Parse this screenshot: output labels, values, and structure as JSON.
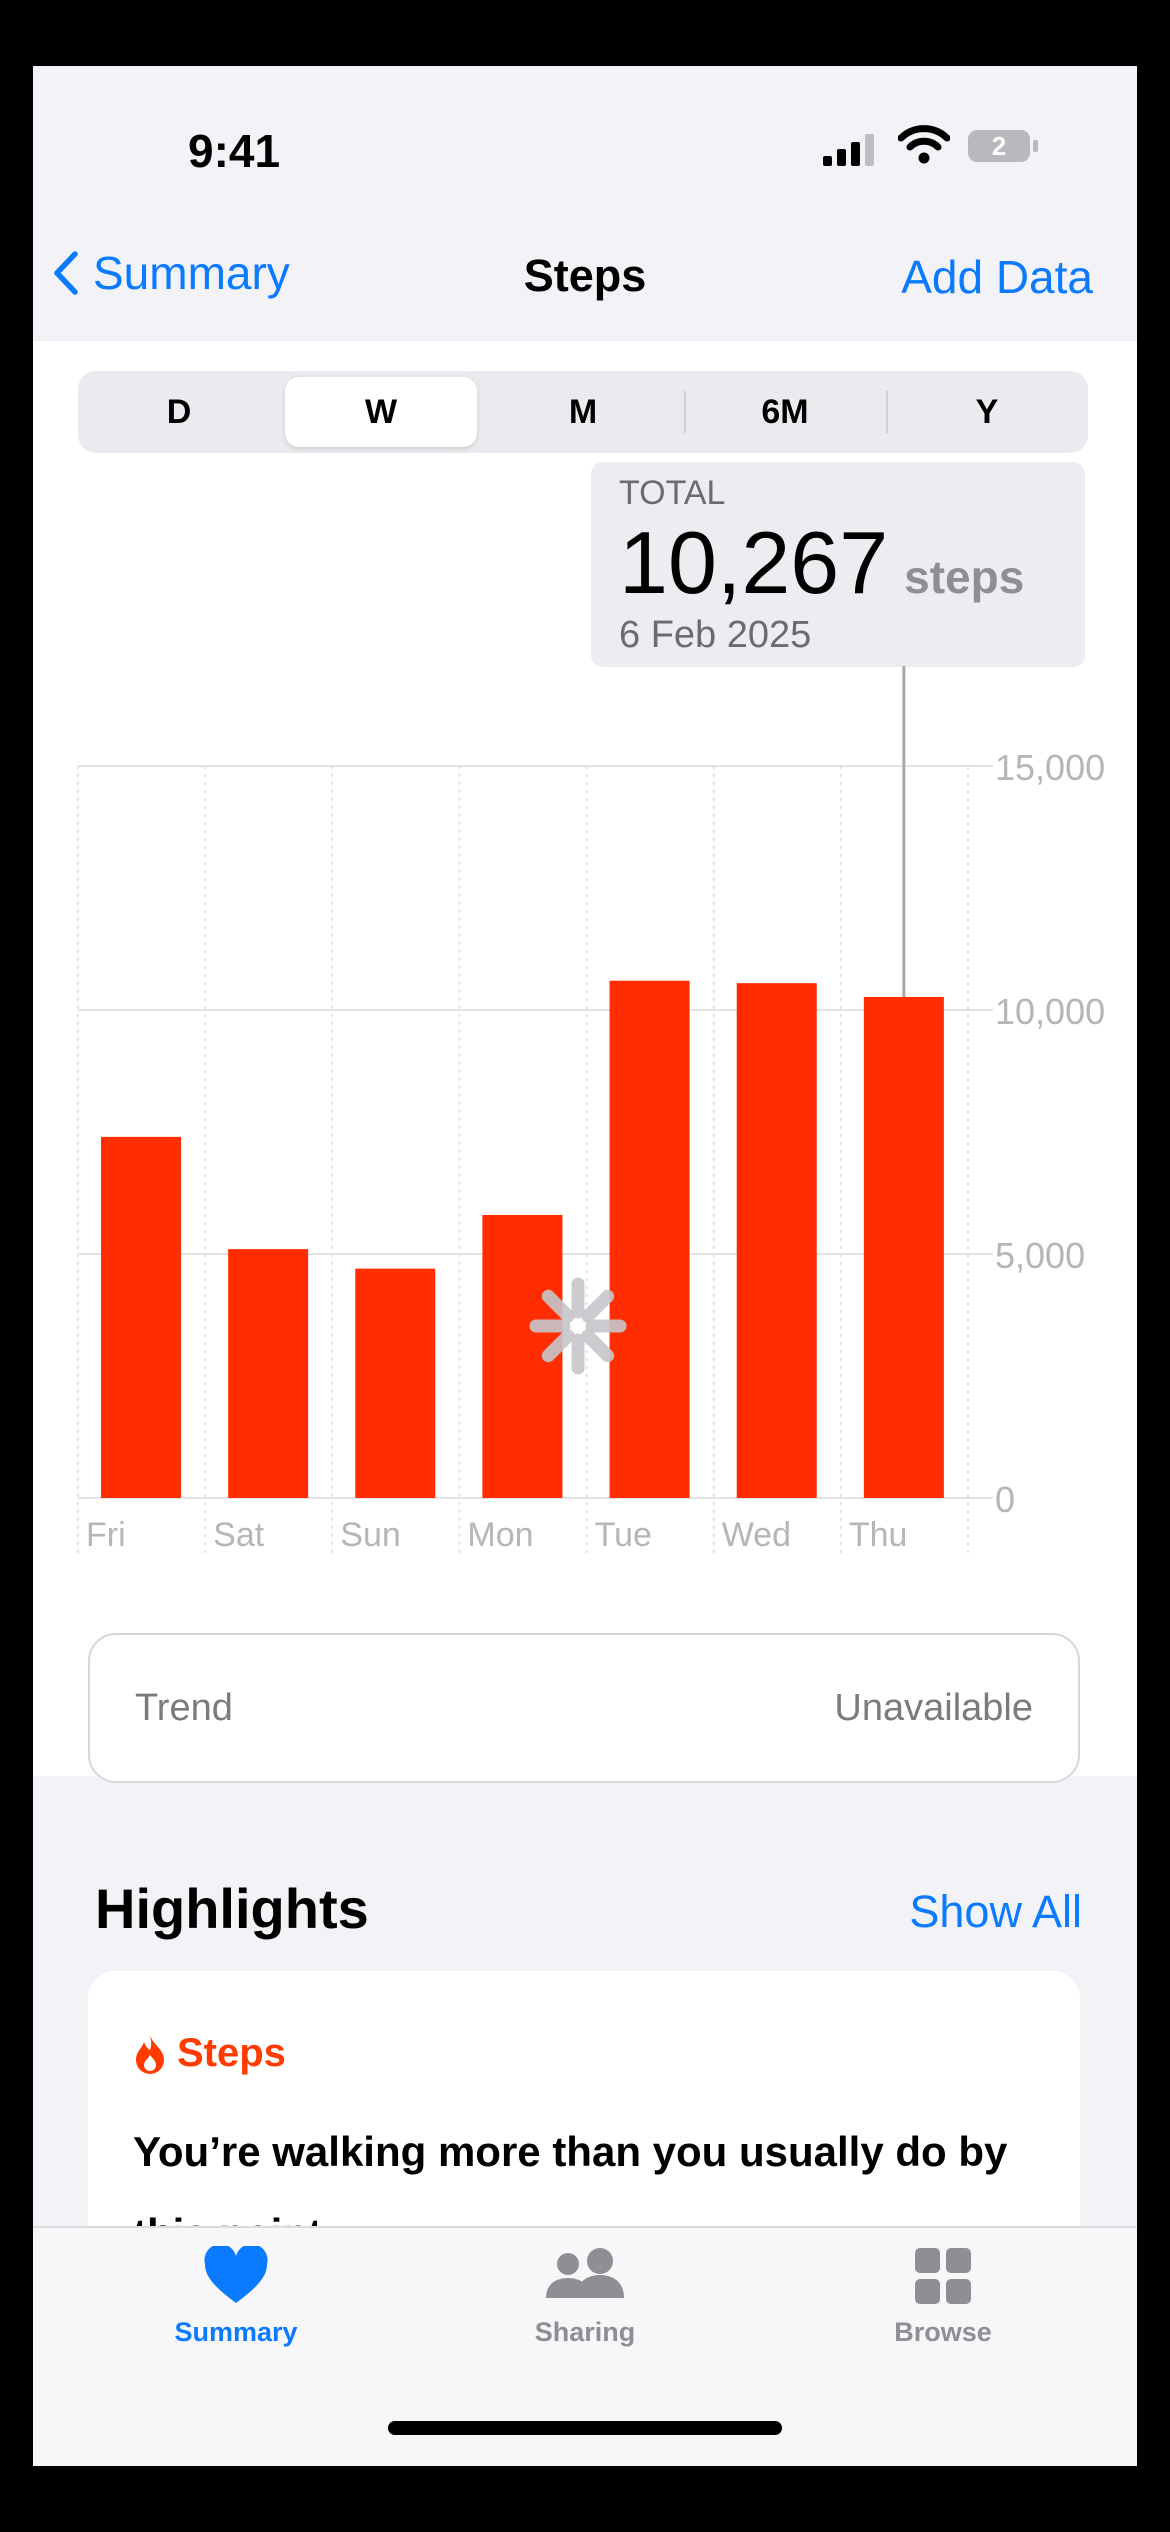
{
  "status_bar": {
    "time": "9:41",
    "battery": "2"
  },
  "nav": {
    "back_label": "Summary",
    "title": "Steps",
    "action_label": "Add Data"
  },
  "segments": [
    "D",
    "W",
    "M",
    "6M",
    "Y"
  ],
  "selected_segment": "W",
  "callout": {
    "label": "TOTAL",
    "value": "10,267",
    "unit": "steps",
    "date": "6 Feb 2025"
  },
  "chart_data": {
    "type": "bar",
    "categories": [
      "Fri",
      "Sat",
      "Sun",
      "Mon",
      "Tue",
      "Wed",
      "Thu"
    ],
    "values": [
      7400,
      5100,
      4700,
      5800,
      10600,
      10550,
      10267
    ],
    "ylim": [
      0,
      15000
    ],
    "y_ticks": [
      "15,000",
      "10,000",
      "5,000",
      "0"
    ],
    "selected_category": "Thu",
    "grid": true,
    "color": "#ff2d00"
  },
  "trend": {
    "label": "Trend",
    "value": "Unavailable"
  },
  "highlights": {
    "title": "Highlights",
    "show_all": "Show All",
    "card": {
      "category": "Steps",
      "text": "You’re walking more than you usually do by this point"
    }
  },
  "tabs": [
    {
      "label": "Summary",
      "icon": "heart-icon",
      "active": true
    },
    {
      "label": "Sharing",
      "icon": "people-icon",
      "active": false
    },
    {
      "label": "Browse",
      "icon": "grid-icon",
      "active": false
    }
  ],
  "colors": {
    "accent": "#0a7aff",
    "bar": "#ff2d00",
    "tab_inactive": "#8e8e93"
  }
}
